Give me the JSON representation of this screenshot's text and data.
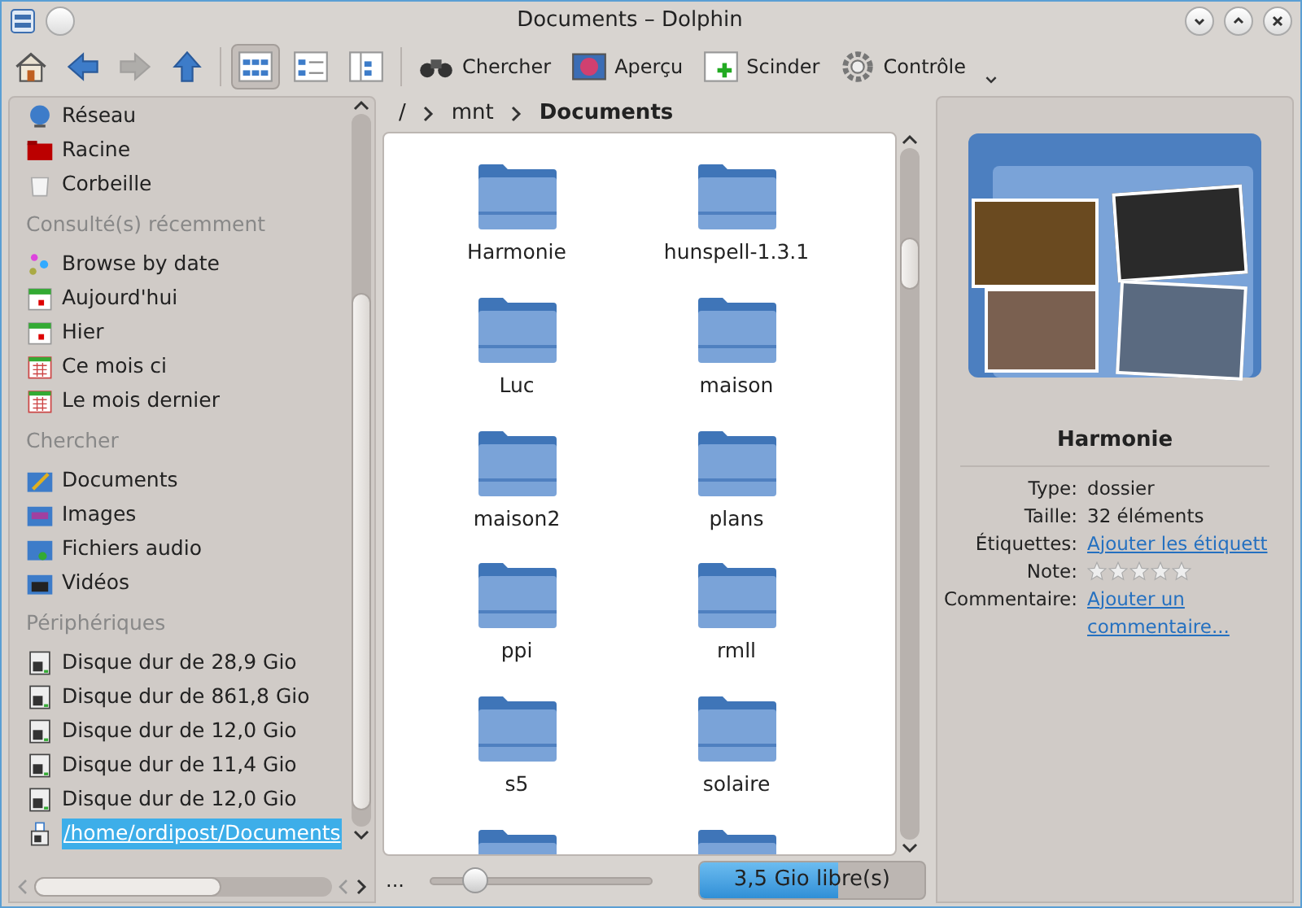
{
  "window": {
    "title": "Documents – Dolphin"
  },
  "toolbar": {
    "navigation": [
      {
        "kind": "home",
        "disabled": false
      },
      {
        "kind": "back",
        "disabled": false
      },
      {
        "kind": "forward",
        "disabled": true
      },
      {
        "kind": "up",
        "disabled": false
      }
    ],
    "view_modes": [
      {
        "kind": "icons",
        "selected": true
      },
      {
        "kind": "details",
        "selected": false
      },
      {
        "kind": "columns",
        "selected": false
      }
    ],
    "actions": [
      {
        "kind": "search",
        "label": "Chercher"
      },
      {
        "kind": "preview",
        "label": "Aperçu"
      },
      {
        "kind": "split",
        "label": "Scinder"
      },
      {
        "kind": "control",
        "label": "Contrôle"
      }
    ]
  },
  "places": [
    {
      "items": [
        {
          "kind": "network",
          "label": "Réseau",
          "selected": false
        },
        {
          "kind": "root",
          "label": "Racine",
          "selected": false
        },
        {
          "kind": "trash",
          "label": "Corbeille",
          "selected": false
        }
      ]
    },
    {
      "title": "Consulté(s) récemment",
      "items": [
        {
          "kind": "timeline",
          "label": "Browse by date",
          "selected": false
        },
        {
          "kind": "day",
          "label": "Aujourd'hui",
          "selected": false
        },
        {
          "kind": "day",
          "label": "Hier",
          "selected": false
        },
        {
          "kind": "month",
          "label": "Ce mois ci",
          "selected": false
        },
        {
          "kind": "month",
          "label": "Le mois dernier",
          "selected": false
        }
      ]
    },
    {
      "title": "Chercher",
      "items": [
        {
          "kind": "documents",
          "label": "Documents",
          "selected": false
        },
        {
          "kind": "images",
          "label": "Images",
          "selected": false
        },
        {
          "kind": "audio",
          "label": "Fichiers audio",
          "selected": false
        },
        {
          "kind": "videos",
          "label": "Vidéos",
          "selected": false
        }
      ]
    },
    {
      "title": "Périphériques",
      "items": [
        {
          "kind": "disk",
          "label": "Disque dur de 28,9 Gio",
          "selected": false
        },
        {
          "kind": "disk",
          "label": "Disque dur de 861,8 Gio",
          "selected": false
        },
        {
          "kind": "disk",
          "label": "Disque dur de 12,0 Gio",
          "selected": false
        },
        {
          "kind": "disk",
          "label": "Disque dur de 11,4 Gio",
          "selected": false
        },
        {
          "kind": "disk",
          "label": "Disque dur de 12,0 Gio",
          "selected": false
        },
        {
          "kind": "removable",
          "label": "/home/ordipost/Documents",
          "selected": true
        }
      ]
    }
  ],
  "breadcrumb": [
    {
      "label": "/",
      "current": false
    },
    {
      "label": "mnt",
      "current": false
    },
    {
      "label": "Documents",
      "current": true
    }
  ],
  "folders": [
    {
      "name": "Harmonie"
    },
    {
      "name": "hunspell-1.3.1"
    },
    {
      "name": "Luc"
    },
    {
      "name": "maison"
    },
    {
      "name": "maison2"
    },
    {
      "name": "plans"
    },
    {
      "name": "ppi"
    },
    {
      "name": "rmll"
    },
    {
      "name": "s5"
    },
    {
      "name": "solaire"
    }
  ],
  "status_bar": {
    "ellipsis": "...",
    "zoom": {
      "level": 0.2
    },
    "free_space": {
      "label": "3,5 Gio libre(s)",
      "level": 0.62
    }
  },
  "information": {
    "name": "Harmonie",
    "fields": [
      {
        "kind": "text",
        "label": "Type:",
        "value": "dossier"
      },
      {
        "kind": "text",
        "label": "Taille:",
        "value": "32 éléments"
      },
      {
        "kind": "link",
        "label": "Étiquettes:",
        "value": "Ajouter les étiquett"
      },
      {
        "kind": "rating",
        "label": "Note:",
        "stars": 0
      },
      {
        "kind": "link",
        "label": "Commentaire:",
        "value": "Ajouter un commentaire..."
      }
    ]
  }
}
